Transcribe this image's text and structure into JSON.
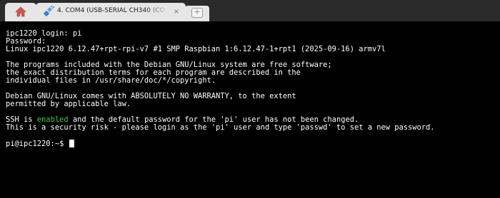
{
  "tabs": {
    "home": {
      "icon": "home-icon"
    },
    "active": {
      "icon": "plug-icon",
      "label": "4. COM4  (USB-SERIAL CH340 (CO",
      "close_label": "×"
    },
    "new_tab": {
      "icon": "plus-icon",
      "label": "+"
    }
  },
  "terminal": {
    "lines": [
      "ipc1220 login: pi",
      "Password:",
      "Linux ipc1220 6.12.47+rpt-rpi-v7 #1 SMP Raspbian 1:6.12.47-1+rpt1 (2025-09-16) armv7l",
      "",
      "The programs included with the Debian GNU/Linux system are free software;",
      "the exact distribution terms for each program are described in the",
      "individual files in /usr/share/doc/*/copyright.",
      "",
      "Debian GNU/Linux comes with ABSOLUTELY NO WARRANTY, to the extent",
      "permitted by applicable law.",
      ""
    ],
    "ssh_line": {
      "before": "SSH is ",
      "highlight": "enabled",
      "after": " and the default password for the 'pi' user has not been changed."
    },
    "security_line": "This is a security risk - please login as the 'pi' user and type 'passwd' to set a new password.",
    "prompt": "pi@ipc1220:~$ "
  },
  "colors": {
    "background": "#000000",
    "text": "#ffffff",
    "highlight": "#3cc84e",
    "tab_bg": "#e6e6e6",
    "tabbar_bg": "#2b2b2b"
  }
}
